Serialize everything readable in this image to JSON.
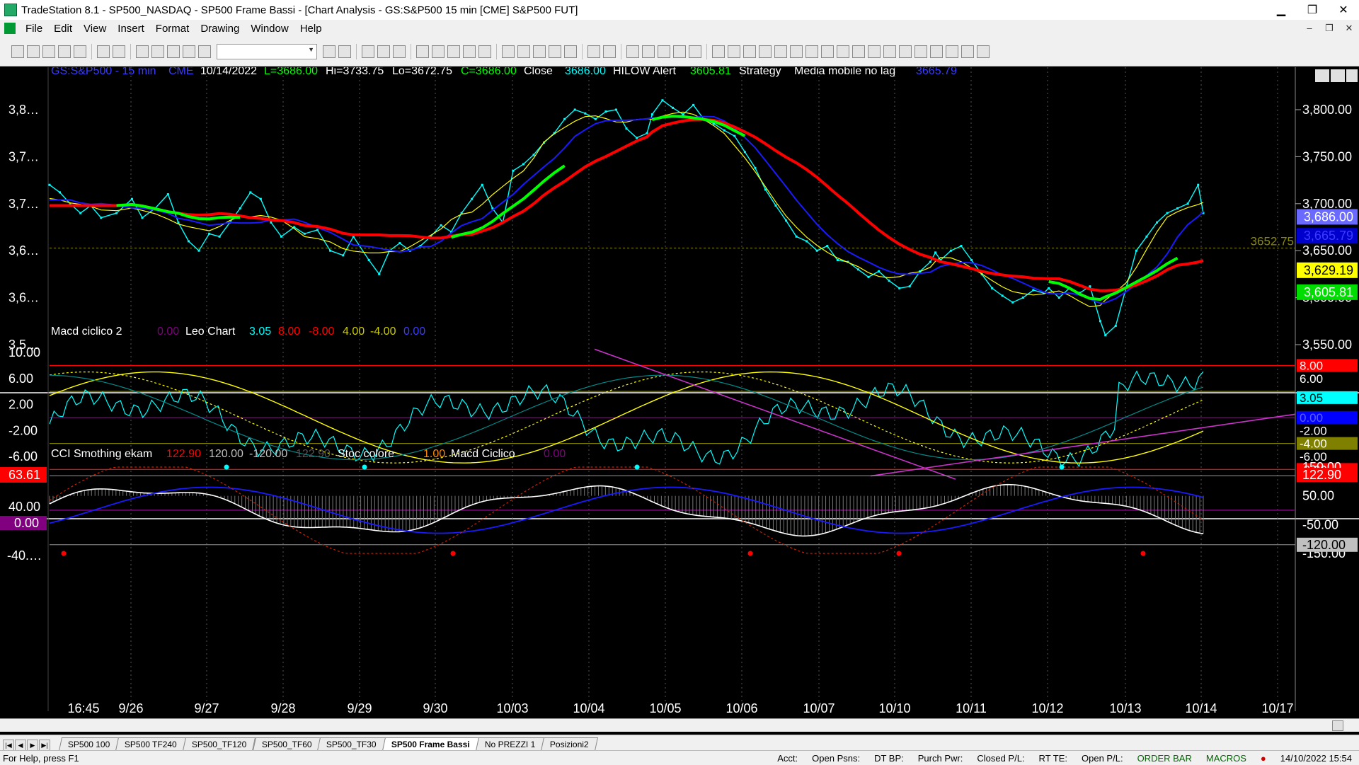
{
  "window": {
    "title": "TradeStation 8.1 - SP500_NASDAQ - SP500 Frame Bassi - [Chart Analysis - GS:S&P500  15 min  [CME] S&P500 FUT]",
    "minimize": "▁",
    "maximize": "❐",
    "close": "✕"
  },
  "menu": [
    "File",
    "Edit",
    "View",
    "Insert",
    "Format",
    "Drawing",
    "Window",
    "Help"
  ],
  "mdi_controls": [
    "‒",
    "❐",
    "✕"
  ],
  "chart": {
    "header": {
      "symbol": "GS:S&P500 - 15 min",
      "exchange": "CME",
      "date": "10/14/2022",
      "last": "L=3686.00",
      "high": "Hi=3733.75",
      "low": "Lo=3672.75",
      "close_val": "C=3686.00",
      "close_label": "Close",
      "close_value": "3686.00",
      "hilow_label": "HILOW Alert",
      "hilow_value": "3605.81",
      "strategy": "Strategy",
      "media_label": "Media mobile no lag",
      "media_value": "3665.79"
    },
    "price_axis": [
      "3,800.00",
      "3,750.00",
      "3,700.00",
      "3,650.00",
      "3,600.00",
      "3,550.00"
    ],
    "price_left_axis": [
      "3,8…",
      "3,7…",
      "3,7…",
      "3,6…",
      "3,6…",
      "3,5…"
    ],
    "price_markers": [
      {
        "text": "3,686.00",
        "bg": "#6a6aff",
        "fg": "#fff"
      },
      {
        "text": "3,665.79",
        "bg": "#0000cc",
        "fg": "#3c3cff"
      },
      {
        "text": "3,629.19",
        "bg": "#ffff00",
        "fg": "#000"
      },
      {
        "text": "3,605.81",
        "bg": "#00dd00",
        "fg": "#fff"
      }
    ],
    "dotted_level": "3652.75",
    "macd_panel": {
      "title": "Macd ciclico 2",
      "v1": "0.00",
      "leo": "Leo Chart",
      "v2": "3.05",
      "v3": "8.00",
      "v4": "-8.00",
      "v5": "4.00",
      "v6": "-4.00",
      "v7": "0.00",
      "axis": [
        "10.00",
        "6.00",
        "2.00",
        "-2.00",
        "-6.00"
      ],
      "markers": [
        {
          "text": "8.00",
          "bg": "#ff0000",
          "fg": "#fff"
        },
        {
          "text": "6.00",
          "bg": "#000",
          "fg": "#fff"
        },
        {
          "text": "3.05",
          "bg": "#00ffff",
          "fg": "#000"
        },
        {
          "text": "0.00",
          "bg": "#0000ff",
          "fg": "#6060ff"
        },
        {
          "text": "-2.00",
          "bg": "#000",
          "fg": "#fff"
        },
        {
          "text": "-4.00",
          "bg": "#808000",
          "fg": "#fff"
        },
        {
          "text": "-6.00",
          "bg": "#000",
          "fg": "#fff"
        },
        {
          "text": "-8.00",
          "bg": "#ff0000",
          "fg": "#fff"
        }
      ]
    },
    "cci_panel": {
      "title": "CCI Smothing ekam",
      "v1": "122.90",
      "v2": "120.00",
      "v3": "-120.00",
      "v4": "122.90",
      "stoc": "Stoc colore",
      "v5": "1.00",
      "macd": "Macd Ciclico",
      "v6": "0.00",
      "left_axis": [
        "63.61",
        "40.00",
        "0.00",
        "-40.…"
      ],
      "axis": [
        "150.00",
        "50.00",
        "-50.00",
        "-150.00"
      ],
      "markers": [
        {
          "text": "122.90",
          "bg": "#ff0000",
          "fg": "#fff"
        },
        {
          "text": "-120.00",
          "bg": "#c0c0c0",
          "fg": "#000"
        }
      ]
    },
    "dates": [
      "16:45",
      "9/26",
      "9/27",
      "9/28",
      "9/29",
      "9/30",
      "10/03",
      "10/04",
      "10/05",
      "10/06",
      "10/07",
      "10/10",
      "10/11",
      "10/12",
      "10/13",
      "10/14",
      "10/17"
    ],
    "colors": {
      "red": "#ff0000",
      "green": "#00ff00",
      "blue": "#1a1aff",
      "cyan": "#00ffff",
      "yellow": "#ffff00",
      "magenta": "#cc33cc",
      "grey": "#808080"
    }
  },
  "tabs": [
    "SP500 100",
    "SP500 TF240",
    "SP500_TF120",
    "SP500_TF60",
    "SP500_TF30",
    "SP500 Frame Bassi",
    "No PREZZI 1",
    "Posizioni2"
  ],
  "active_tab": "SP500 Frame Bassi",
  "status": {
    "help": "For Help, press F1",
    "acct": "Acct:",
    "open_psns": "Open Psns:",
    "dt_bp": "DT BP:",
    "purch_pwr": "Purch Pwr:",
    "closed_pl": "Closed P/L:",
    "rt_te": "RT TE:",
    "open_pl": "Open P/L:",
    "order_bar": "ORDER BAR",
    "macros": "MACROS",
    "datetime": "14/10/2022 15:54"
  }
}
